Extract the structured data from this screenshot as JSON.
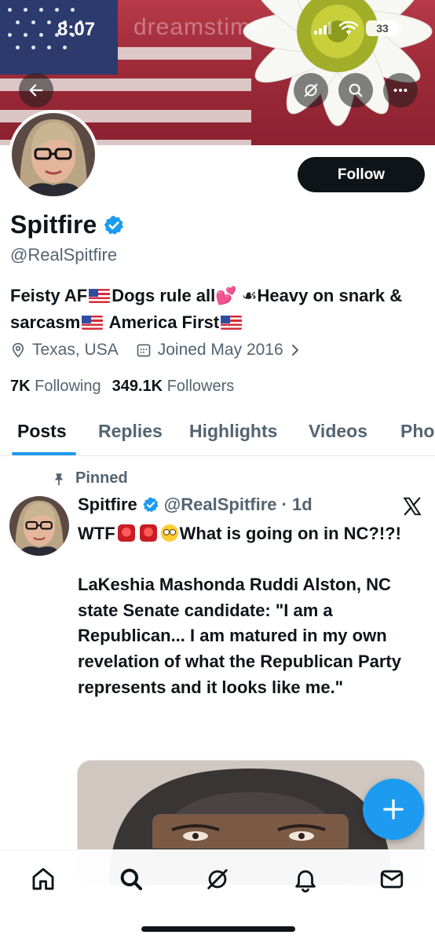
{
  "status_bar": {
    "time": "8:07",
    "battery": "33"
  },
  "banner": {
    "watermark": "dreamstime"
  },
  "header_buttons": {
    "back": "arrow-left-icon",
    "grok": "grok-icon",
    "search": "search-icon",
    "more": "more-icon"
  },
  "profile": {
    "follow_label": "Follow",
    "display_name": "Spitfire",
    "handle": "@RealSpitfire",
    "bio": {
      "part1": "Feisty AF",
      "part2": "Dogs rule all",
      "part3": "Heavy on snark & sarcasm",
      "part4": "America First"
    },
    "location": "Texas, USA",
    "joined": "Joined May 2016",
    "following_count": "7K",
    "following_label": "Following",
    "followers_count": "349.1K",
    "followers_label": "Followers"
  },
  "tabs": [
    "Posts",
    "Replies",
    "Highlights",
    "Videos",
    "Pho"
  ],
  "post": {
    "pinned_label": "Pinned",
    "name": "Spitfire",
    "handle": "@RealSpitfire",
    "time": "· 1d",
    "line1_a": "WTF",
    "line1_b": "What is going on in NC?!?!",
    "body": "LaKeshia Mashonda Ruddi Alston, NC state Senate candidate:  \"I am a Republican... I am matured in my own revelation of what the Republican Party represents and it looks like me.\""
  },
  "colors": {
    "accent": "#1d9bf0",
    "text": "#0f1419",
    "muted": "#536471"
  },
  "bottom_nav": [
    "home-icon",
    "search-icon",
    "grok-icon",
    "notifications-icon",
    "messages-icon"
  ]
}
